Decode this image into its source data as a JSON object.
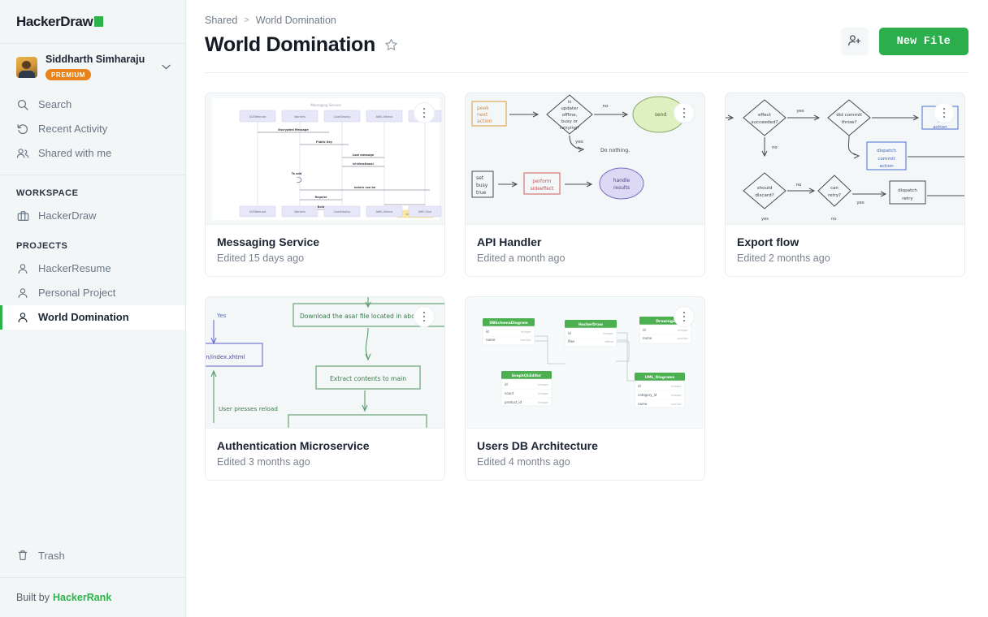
{
  "brand": {
    "name": "HackerDraw",
    "accent": "#2cb34a"
  },
  "user": {
    "name": "Siddharth Simharaju",
    "badge": "PREMIUM",
    "avatar_icon": "user-photo-avatar",
    "chevron_icon": "chevron-down-icon"
  },
  "sidebar": {
    "primary_items": [
      {
        "label": "Search",
        "icon": "search-icon"
      },
      {
        "label": "Recent Activity",
        "icon": "history-icon"
      },
      {
        "label": "Shared with me",
        "icon": "users-icon"
      }
    ],
    "workspace_label": "WORKSPACE",
    "workspace_items": [
      {
        "label": "HackerDraw",
        "icon": "briefcase-icon"
      }
    ],
    "projects_label": "PROJECTS",
    "projects": [
      {
        "label": "HackerResume",
        "icon": "person-icon",
        "active": false
      },
      {
        "label": "Personal Project",
        "icon": "person-icon",
        "active": false
      },
      {
        "label": "World Domination",
        "icon": "person-icon",
        "active": true
      }
    ],
    "trash": {
      "label": "Trash",
      "icon": "trash-icon"
    },
    "footer_prefix": "Built by",
    "footer_brand": "HackerRank"
  },
  "header": {
    "breadcrumb": {
      "root": "Shared",
      "separator": ">",
      "current": "World Domination"
    },
    "title": "World Domination",
    "star_icon": "star-outline-icon",
    "share_icon": "add-person-icon",
    "new_file_label": "New File",
    "new_file_color": "#2cae4c"
  },
  "files": [
    {
      "title": "Messaging Service",
      "subtitle": "Edited 15 days ago",
      "thumb_type": "sequence-diagram",
      "thumb": {
        "caption": "Messaging Service",
        "lifelines": [
          "SLEWebroot",
          "Workers",
          "CodeDeploy",
          "AWS Athena",
          "AWS Glue"
        ],
        "messages": [
          "Encrypted Message",
          "Public Key",
          "Last message",
          "bi-directional",
          "To add",
          "extern can be",
          "Regular",
          "Bold"
        ],
        "note": "I obtained it for"
      }
    },
    {
      "title": "API Handler",
      "subtitle": "Edited a month ago",
      "thumb_type": "flowchart-sketch",
      "thumb": {
        "nodes": [
          "peek next action",
          "is updater offline, busy or retrying?",
          "send",
          "Do nothing.",
          "set busy true",
          "perform sideeffect",
          "handle results"
        ],
        "edge_labels": [
          "no",
          "yes"
        ]
      }
    },
    {
      "title": "Export flow",
      "subtitle": "Edited 2 months ago",
      "thumb_type": "flowchart-sketch",
      "thumb": {
        "nodes": [
          "effect succeeded?",
          "did commit throw?",
          "dispatch JS action",
          "dispatch commit action",
          "should discard?",
          "can retry?",
          "dispatch retry"
        ],
        "edge_labels": [
          "yes",
          "no",
          "no",
          "no",
          "yes",
          "yes",
          "no"
        ]
      }
    },
    {
      "title": "Authentication Microservice",
      "subtitle": "Edited 3 months ago",
      "thumb_type": "flowchart-sketch-green",
      "thumb": {
        "nodes": [
          "Yes",
          "ain/index.xhtml",
          "Download the asar file located in   abo",
          "Extract contents to main",
          "User presses reload"
        ]
      }
    },
    {
      "title": "Users DB Architecture",
      "subtitle": "Edited 4 months ago",
      "thumb_type": "er-diagram",
      "thumb": {
        "tables": [
          {
            "name": "DBSchemaDiagram",
            "columns": [
              [
                "id",
                "integer"
              ],
              [
                "name",
                "varchar"
              ]
            ]
          },
          {
            "name": "HackerDraw",
            "columns": [
              [
                "id",
                "integer"
              ],
              [
                "files",
                "sttext"
              ]
            ]
          },
          {
            "name": "Drawings",
            "columns": [
              [
                "id",
                "integer"
              ],
              [
                "name",
                "varchar"
              ]
            ]
          },
          {
            "name": "GraphQLEditor",
            "columns": [
              [
                "id",
                "integer"
              ],
              [
                "count",
                "integer"
              ],
              [
                "product_id",
                "integer"
              ]
            ]
          },
          {
            "name": "UML_Diagrams",
            "columns": [
              [
                "id",
                "integer"
              ],
              [
                "category_id",
                "integer"
              ],
              [
                "name",
                "varchar"
              ]
            ]
          }
        ],
        "header_color": "#4caf50"
      }
    }
  ]
}
